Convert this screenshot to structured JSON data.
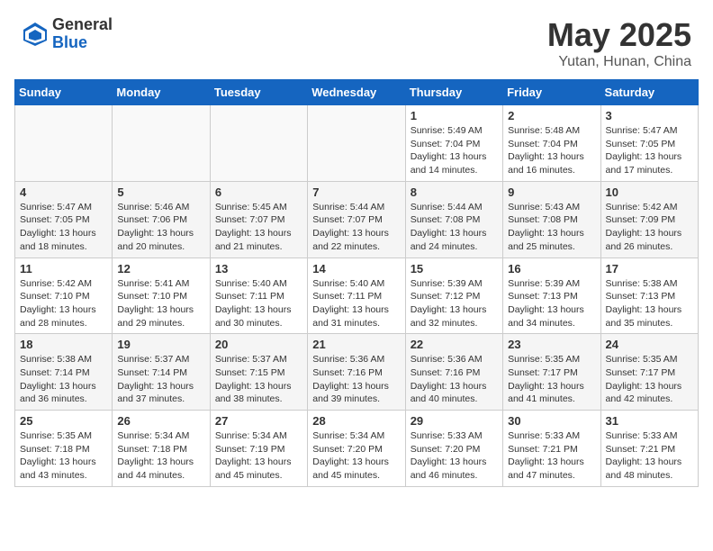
{
  "header": {
    "logo_general": "General",
    "logo_blue": "Blue",
    "month_title": "May 2025",
    "location": "Yutan, Hunan, China"
  },
  "weekdays": [
    "Sunday",
    "Monday",
    "Tuesday",
    "Wednesday",
    "Thursday",
    "Friday",
    "Saturday"
  ],
  "weeks": [
    [
      {
        "day": "",
        "info": ""
      },
      {
        "day": "",
        "info": ""
      },
      {
        "day": "",
        "info": ""
      },
      {
        "day": "",
        "info": ""
      },
      {
        "day": "1",
        "info": "Sunrise: 5:49 AM\nSunset: 7:04 PM\nDaylight: 13 hours\nand 14 minutes."
      },
      {
        "day": "2",
        "info": "Sunrise: 5:48 AM\nSunset: 7:04 PM\nDaylight: 13 hours\nand 16 minutes."
      },
      {
        "day": "3",
        "info": "Sunrise: 5:47 AM\nSunset: 7:05 PM\nDaylight: 13 hours\nand 17 minutes."
      }
    ],
    [
      {
        "day": "4",
        "info": "Sunrise: 5:47 AM\nSunset: 7:05 PM\nDaylight: 13 hours\nand 18 minutes."
      },
      {
        "day": "5",
        "info": "Sunrise: 5:46 AM\nSunset: 7:06 PM\nDaylight: 13 hours\nand 20 minutes."
      },
      {
        "day": "6",
        "info": "Sunrise: 5:45 AM\nSunset: 7:07 PM\nDaylight: 13 hours\nand 21 minutes."
      },
      {
        "day": "7",
        "info": "Sunrise: 5:44 AM\nSunset: 7:07 PM\nDaylight: 13 hours\nand 22 minutes."
      },
      {
        "day": "8",
        "info": "Sunrise: 5:44 AM\nSunset: 7:08 PM\nDaylight: 13 hours\nand 24 minutes."
      },
      {
        "day": "9",
        "info": "Sunrise: 5:43 AM\nSunset: 7:08 PM\nDaylight: 13 hours\nand 25 minutes."
      },
      {
        "day": "10",
        "info": "Sunrise: 5:42 AM\nSunset: 7:09 PM\nDaylight: 13 hours\nand 26 minutes."
      }
    ],
    [
      {
        "day": "11",
        "info": "Sunrise: 5:42 AM\nSunset: 7:10 PM\nDaylight: 13 hours\nand 28 minutes."
      },
      {
        "day": "12",
        "info": "Sunrise: 5:41 AM\nSunset: 7:10 PM\nDaylight: 13 hours\nand 29 minutes."
      },
      {
        "day": "13",
        "info": "Sunrise: 5:40 AM\nSunset: 7:11 PM\nDaylight: 13 hours\nand 30 minutes."
      },
      {
        "day": "14",
        "info": "Sunrise: 5:40 AM\nSunset: 7:11 PM\nDaylight: 13 hours\nand 31 minutes."
      },
      {
        "day": "15",
        "info": "Sunrise: 5:39 AM\nSunset: 7:12 PM\nDaylight: 13 hours\nand 32 minutes."
      },
      {
        "day": "16",
        "info": "Sunrise: 5:39 AM\nSunset: 7:13 PM\nDaylight: 13 hours\nand 34 minutes."
      },
      {
        "day": "17",
        "info": "Sunrise: 5:38 AM\nSunset: 7:13 PM\nDaylight: 13 hours\nand 35 minutes."
      }
    ],
    [
      {
        "day": "18",
        "info": "Sunrise: 5:38 AM\nSunset: 7:14 PM\nDaylight: 13 hours\nand 36 minutes."
      },
      {
        "day": "19",
        "info": "Sunrise: 5:37 AM\nSunset: 7:14 PM\nDaylight: 13 hours\nand 37 minutes."
      },
      {
        "day": "20",
        "info": "Sunrise: 5:37 AM\nSunset: 7:15 PM\nDaylight: 13 hours\nand 38 minutes."
      },
      {
        "day": "21",
        "info": "Sunrise: 5:36 AM\nSunset: 7:16 PM\nDaylight: 13 hours\nand 39 minutes."
      },
      {
        "day": "22",
        "info": "Sunrise: 5:36 AM\nSunset: 7:16 PM\nDaylight: 13 hours\nand 40 minutes."
      },
      {
        "day": "23",
        "info": "Sunrise: 5:35 AM\nSunset: 7:17 PM\nDaylight: 13 hours\nand 41 minutes."
      },
      {
        "day": "24",
        "info": "Sunrise: 5:35 AM\nSunset: 7:17 PM\nDaylight: 13 hours\nand 42 minutes."
      }
    ],
    [
      {
        "day": "25",
        "info": "Sunrise: 5:35 AM\nSunset: 7:18 PM\nDaylight: 13 hours\nand 43 minutes."
      },
      {
        "day": "26",
        "info": "Sunrise: 5:34 AM\nSunset: 7:18 PM\nDaylight: 13 hours\nand 44 minutes."
      },
      {
        "day": "27",
        "info": "Sunrise: 5:34 AM\nSunset: 7:19 PM\nDaylight: 13 hours\nand 45 minutes."
      },
      {
        "day": "28",
        "info": "Sunrise: 5:34 AM\nSunset: 7:20 PM\nDaylight: 13 hours\nand 45 minutes."
      },
      {
        "day": "29",
        "info": "Sunrise: 5:33 AM\nSunset: 7:20 PM\nDaylight: 13 hours\nand 46 minutes."
      },
      {
        "day": "30",
        "info": "Sunrise: 5:33 AM\nSunset: 7:21 PM\nDaylight: 13 hours\nand 47 minutes."
      },
      {
        "day": "31",
        "info": "Sunrise: 5:33 AM\nSunset: 7:21 PM\nDaylight: 13 hours\nand 48 minutes."
      }
    ]
  ]
}
